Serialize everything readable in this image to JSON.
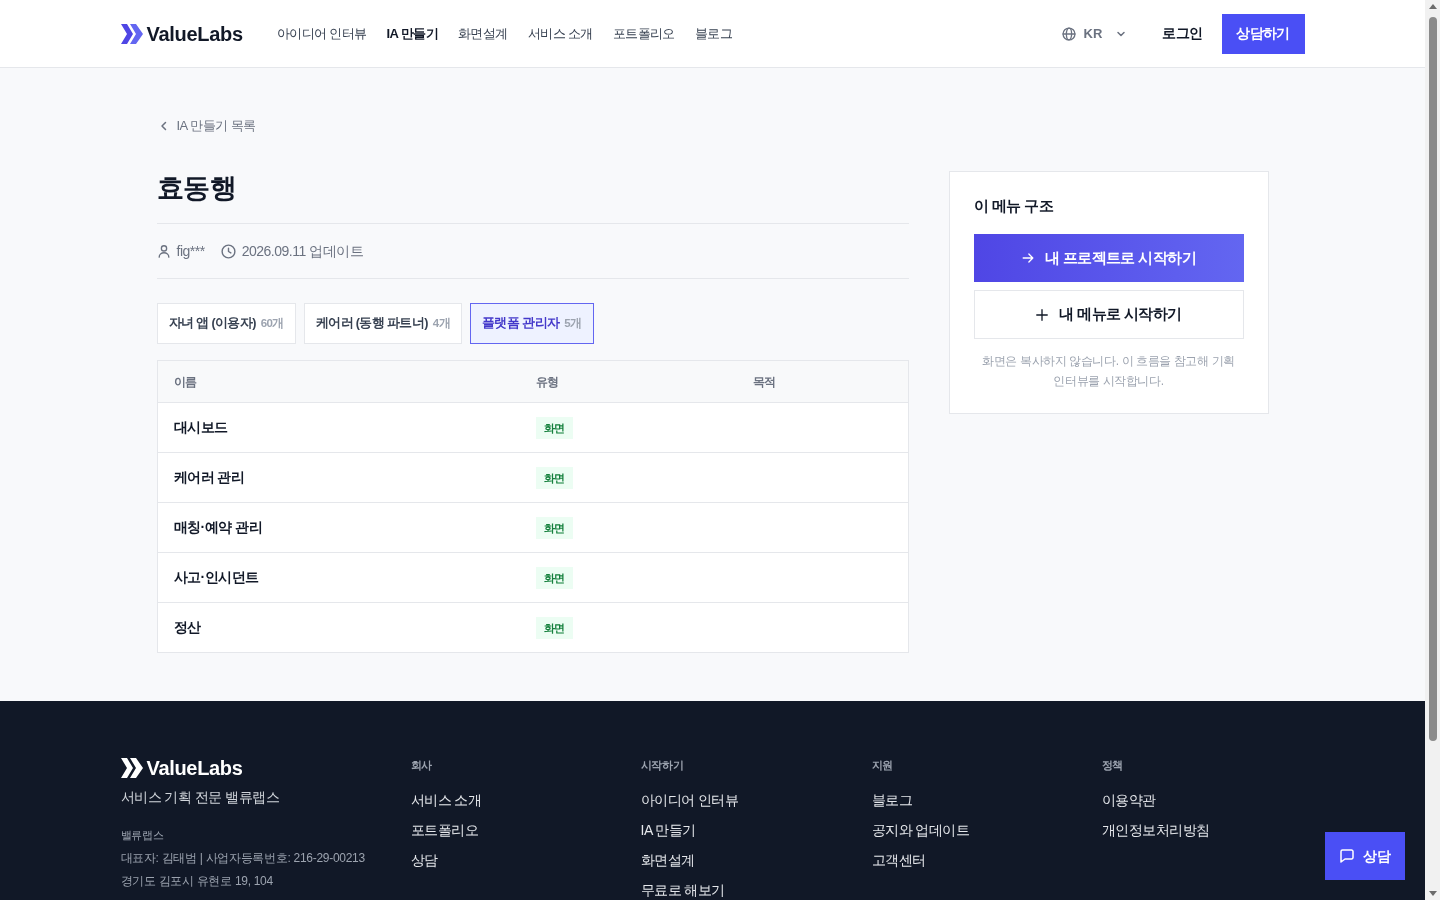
{
  "header": {
    "logo": "ValueLabs",
    "nav": [
      {
        "label": "아이디어 인터뷰",
        "selected": false
      },
      {
        "label": "IA 만들기",
        "selected": true
      },
      {
        "label": "화면설계",
        "selected": false
      },
      {
        "label": "서비스 소개",
        "selected": false
      },
      {
        "label": "포트폴리오",
        "selected": false
      },
      {
        "label": "블로그",
        "selected": false
      }
    ],
    "language": "KR",
    "login": "로그인",
    "cta": "상담하기"
  },
  "breadcrumb": {
    "label": "IA 만들기 목록"
  },
  "page": {
    "title": "효동행",
    "author": "fig***",
    "updated": "2026.09.11 업데이트"
  },
  "tabs": [
    {
      "label": "자녀 앱 (이용자)",
      "count": "60개",
      "selected": false
    },
    {
      "label": "케어러 (동행 파트너)",
      "count": "4개",
      "selected": false
    },
    {
      "label": "플랫폼 관리자",
      "count": "5개",
      "selected": true
    }
  ],
  "table": {
    "columns": [
      "이름",
      "유형",
      "목적"
    ],
    "rows": [
      {
        "name": "대시보드",
        "type": "화면"
      },
      {
        "name": "케어러 관리",
        "type": "화면"
      },
      {
        "name": "매칭·예약 관리",
        "type": "화면"
      },
      {
        "name": "사고·인시던트",
        "type": "화면"
      },
      {
        "name": "정산",
        "type": "화면"
      }
    ]
  },
  "sidebar": {
    "title": "이 메뉴 구조",
    "primary_button": "내 프로젝트로 시작하기",
    "secondary_button": "내 메뉴로 시작하기",
    "note": "화면은 복사하지 않습니다. 이 흐름을 참고해 기획 인터뷰를 시작합니다."
  },
  "footer": {
    "logo": "ValueLabs",
    "tagline": "서비스 기획 전문 밸류랩스",
    "company": "밸류랩스",
    "info": [
      "대표자: 김태범 | 사업자등록번호: 216-29-00213",
      "경기도 김포시 유현로 19, 104"
    ],
    "columns": [
      {
        "heading": "회사",
        "links": [
          "서비스 소개",
          "포트폴리오",
          "상담"
        ]
      },
      {
        "heading": "시작하기",
        "links": [
          "아이디어 인터뷰",
          "IA 만들기",
          "화면설계",
          "무료로 해보기"
        ]
      },
      {
        "heading": "지원",
        "links": [
          "블로그",
          "공지와 업데이트",
          "고객센터"
        ]
      },
      {
        "heading": "정책",
        "links": [
          "이용약관",
          "개인정보처리방침"
        ]
      }
    ]
  },
  "chat_button": "상담"
}
